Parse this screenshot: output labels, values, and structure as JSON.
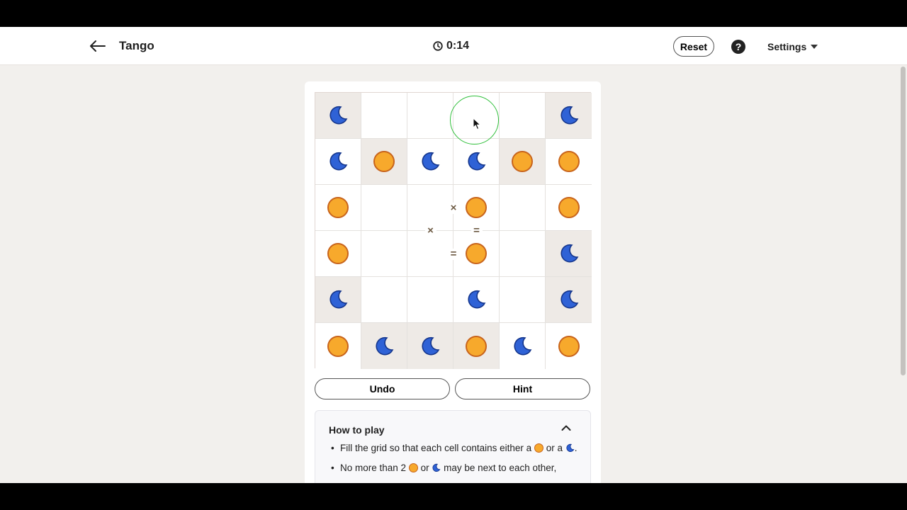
{
  "header": {
    "title": "Tango",
    "timer": "0:14",
    "reset_label": "Reset",
    "help_label": "?",
    "settings_label": "Settings"
  },
  "colors": {
    "sun": "#f7a92c",
    "moon": "#2f62d6",
    "locked_cell": "#eeeae6",
    "cursor_ring": "#2fbf3a"
  },
  "board": {
    "size": 6,
    "cells": [
      [
        "moon",
        "",
        "",
        "",
        "",
        "moon"
      ],
      [
        "moon",
        "sun",
        "moon",
        "moon",
        "sun",
        "sun"
      ],
      [
        "sun",
        "",
        "",
        "sun",
        "",
        "sun"
      ],
      [
        "sun",
        "",
        "",
        "sun",
        "",
        "moon"
      ],
      [
        "moon",
        "",
        "",
        "moon",
        "",
        "moon"
      ],
      [
        "sun",
        "moon",
        "moon",
        "sun",
        "moon",
        "sun"
      ]
    ],
    "locked": [
      [
        true,
        false,
        false,
        false,
        false,
        true
      ],
      [
        false,
        true,
        false,
        false,
        true,
        false
      ],
      [
        false,
        false,
        false,
        false,
        false,
        false
      ],
      [
        false,
        false,
        false,
        false,
        false,
        true
      ],
      [
        true,
        false,
        false,
        false,
        false,
        true
      ],
      [
        false,
        true,
        true,
        true,
        false,
        false
      ]
    ],
    "constraints": [
      {
        "symbol": "×",
        "between": [
          [
            2,
            2
          ],
          [
            2,
            3
          ]
        ]
      },
      {
        "symbol": "×",
        "between": [
          [
            2,
            2
          ],
          [
            3,
            2
          ]
        ]
      },
      {
        "symbol": "=",
        "between": [
          [
            2,
            3
          ],
          [
            3,
            3
          ]
        ]
      },
      {
        "symbol": "=",
        "between": [
          [
            3,
            2
          ],
          [
            3,
            3
          ]
        ]
      }
    ]
  },
  "actions": {
    "undo_label": "Undo",
    "hint_label": "Hint"
  },
  "how_to_play": {
    "title": "How to play",
    "rule1_prefix": "Fill the grid so that each cell contains either a",
    "rule1_middle": "or a",
    "rule1_suffix": ".",
    "rule2_prefix": "No more than 2",
    "rule2_middle": "or",
    "rule2_suffix": "may be next to each other,"
  }
}
